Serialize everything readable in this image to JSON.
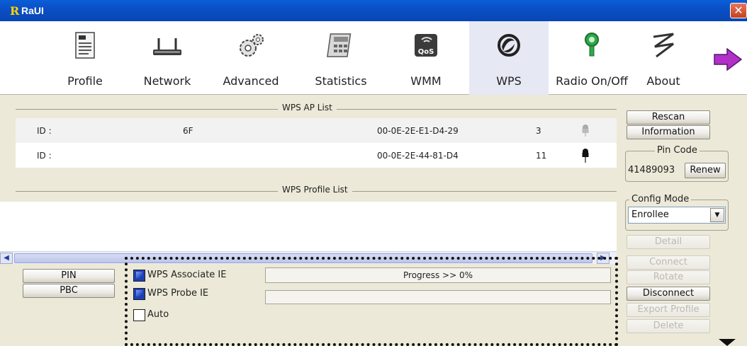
{
  "window": {
    "logo": "R",
    "title": "RaUI",
    "close_glyph": "✕"
  },
  "toolbar": {
    "items": [
      {
        "label": "Profile",
        "icon": "profile-icon"
      },
      {
        "label": "Network",
        "icon": "network-icon"
      },
      {
        "label": "Advanced",
        "icon": "advanced-icon"
      },
      {
        "label": "Statistics",
        "icon": "statistics-icon"
      },
      {
        "label": "WMM",
        "icon": "wmm-icon",
        "badge": "QoS"
      },
      {
        "label": "WPS",
        "icon": "wps-icon",
        "active": true
      },
      {
        "label": "Radio On/Off",
        "icon": "radio-icon"
      },
      {
        "label": "About",
        "icon": "about-icon"
      }
    ],
    "next_icon": "arrow-right-icon"
  },
  "ap_list": {
    "title": "WPS AP List",
    "rows": [
      {
        "id_label": "ID :",
        "ssid": "6F",
        "bssid": "00-0E-2E-E1-D4-29",
        "channel": "3",
        "icon": "key-icon"
      },
      {
        "id_label": "ID :",
        "ssid": "",
        "bssid": "00-0E-2E-44-81-D4",
        "channel": "11",
        "icon": "key-icon"
      }
    ]
  },
  "profile_list": {
    "title": "WPS Profile List"
  },
  "actions": {
    "pin": "PIN",
    "pbc": "PBC"
  },
  "options": {
    "associate_ie": {
      "label": "WPS Associate IE",
      "checked": true
    },
    "probe_ie": {
      "label": "WPS Probe IE",
      "checked": true
    },
    "auto": {
      "label": "Auto",
      "checked": false
    }
  },
  "progress": {
    "text": "Progress >> 0%",
    "value": 0
  },
  "side": {
    "rescan": "Rescan",
    "information": "Information",
    "pin_code_title": "Pin Code",
    "pin_code_value": "41489093",
    "renew": "Renew",
    "config_mode_title": "Config Mode",
    "config_mode_value": "Enrollee",
    "detail": "Detail",
    "connect": "Connect",
    "rotate": "Rotate",
    "disconnect": "Disconnect",
    "export_profile": "Export Profile",
    "delete": "Delete"
  },
  "colors": {
    "titlebar": "#0b4fc6",
    "panel": "#ece9d8",
    "checked": "#1f3fb8",
    "wps_active": "#e6e8f4"
  }
}
